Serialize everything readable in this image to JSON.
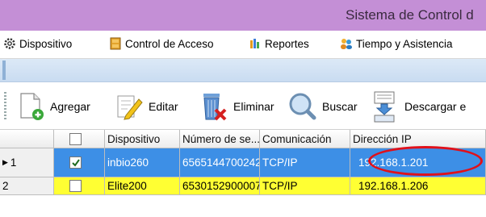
{
  "window": {
    "title": "Sistema de Control d"
  },
  "menu": {
    "items": [
      {
        "label": "Dispositivo",
        "icon": "gear-icon"
      },
      {
        "label": "Control de Acceso",
        "icon": "door-icon"
      },
      {
        "label": "Reportes",
        "icon": "report-icon"
      },
      {
        "label": "Tiempo y Asistencia",
        "icon": "users-icon"
      }
    ]
  },
  "toolbar": {
    "add_label": "Agregar",
    "edit_label": "Editar",
    "delete_label": "Eliminar",
    "search_label": "Buscar",
    "download_label": "Descargar e"
  },
  "table": {
    "headers": [
      "Dispositivo",
      "Número de se...",
      "Comunicación",
      "Dirección IP"
    ],
    "rows": [
      {
        "row_label": "1",
        "checked": true,
        "device": "inbio260",
        "serial": "6565144700242",
        "comm": "TCP/IP",
        "ip": "192.168.1.201"
      },
      {
        "row_label": "2",
        "checked": false,
        "device": "Elite200",
        "serial": "6530152900007",
        "comm": "TCP/IP",
        "ip": "192.168.1.206"
      }
    ]
  },
  "colors": {
    "titlebar": "#c48fd6",
    "selected_row": "#3d8fe6",
    "highlight_row": "#ffff33",
    "annotation": "#e0101a"
  }
}
